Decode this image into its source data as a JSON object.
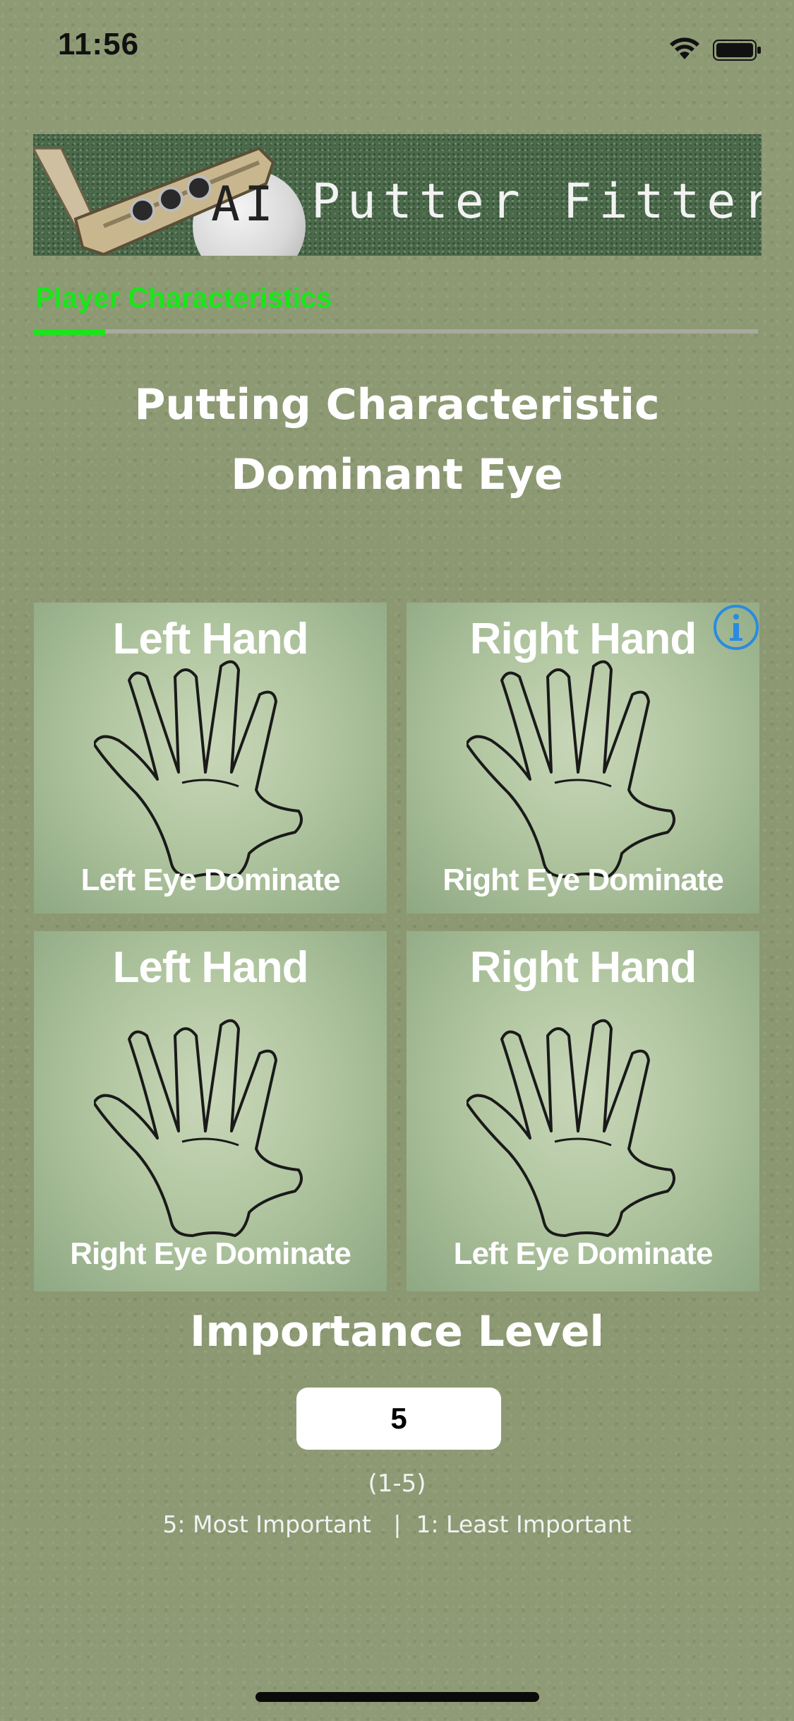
{
  "status_bar": {
    "time": "11:56"
  },
  "banner": {
    "ai_text": "AI",
    "title": "Putter Fitter"
  },
  "tab": {
    "label": "Player Characteristics"
  },
  "heading": {
    "line1": "Putting Characteristic",
    "line2": "Dominant Eye"
  },
  "options": [
    {
      "top": "Left Hand",
      "bottom": "Left Eye Dominate"
    },
    {
      "top": "Right Hand",
      "bottom": "Right Eye Dominate"
    },
    {
      "top": "Left Hand",
      "bottom": "Right Eye Dominate"
    },
    {
      "top": "Right Hand",
      "bottom": "Left Eye Dominate"
    }
  ],
  "importance": {
    "heading": "Importance Level",
    "value": "5",
    "range": "(1-5)",
    "legend": "5: Most Important   |  1: Least Important"
  },
  "colors": {
    "accent": "#19e619",
    "background": "#8c9872",
    "info": "#2a8be0"
  },
  "icons": [
    "wifi-icon",
    "battery-icon",
    "hand-icon",
    "info-icon",
    "putter-icon",
    "golf-ball-icon"
  ]
}
